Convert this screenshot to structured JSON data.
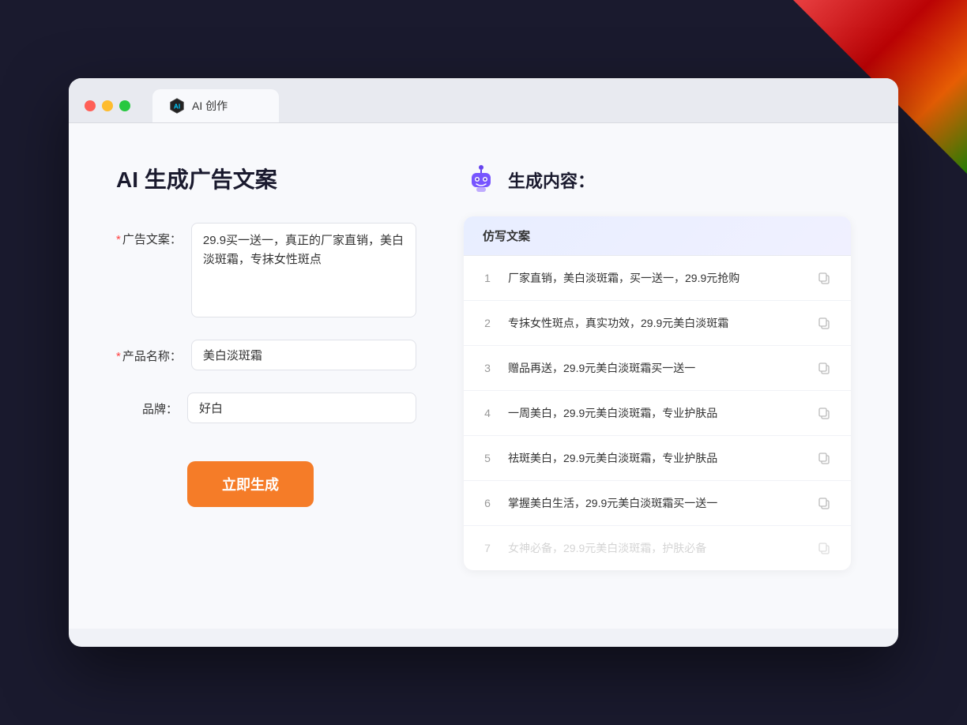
{
  "browser": {
    "tab_title": "AI 创作",
    "window_controls": {
      "close_label": "close",
      "minimize_label": "minimize",
      "maximize_label": "maximize"
    }
  },
  "left_panel": {
    "page_title": "AI 生成广告文案",
    "form": {
      "ad_copy_label": "广告文案：",
      "ad_copy_required": "*",
      "ad_copy_value": "29.9买一送一，真正的厂家直销，美白淡斑霜，专抹女性斑点",
      "product_name_label": "产品名称：",
      "product_name_required": "*",
      "product_name_value": "美白淡斑霜",
      "brand_label": "品牌：",
      "brand_value": "好白",
      "generate_btn_label": "立即生成"
    }
  },
  "right_panel": {
    "title": "生成内容：",
    "card_header": "仿写文案",
    "results": [
      {
        "num": "1",
        "text": "厂家直销，美白淡斑霜，买一送一，29.9元抢购"
      },
      {
        "num": "2",
        "text": "专抹女性斑点，真实功效，29.9元美白淡斑霜"
      },
      {
        "num": "3",
        "text": "赠品再送，29.9元美白淡斑霜买一送一"
      },
      {
        "num": "4",
        "text": "一周美白，29.9元美白淡斑霜，专业护肤品"
      },
      {
        "num": "5",
        "text": "祛斑美白，29.9元美白淡斑霜，专业护肤品"
      },
      {
        "num": "6",
        "text": "掌握美白生活，29.9元美白淡斑霜买一送一"
      },
      {
        "num": "7",
        "text": "女神必备，29.9元美白淡斑霜，护肤必备",
        "faded": true
      }
    ]
  }
}
